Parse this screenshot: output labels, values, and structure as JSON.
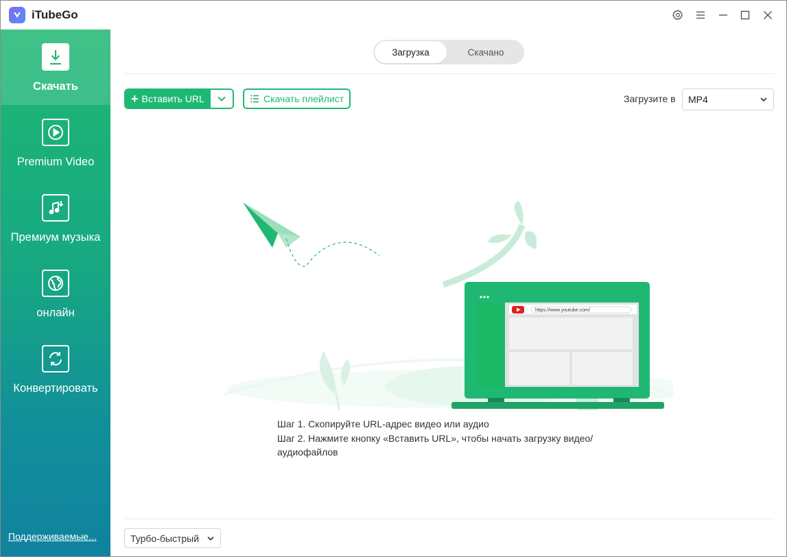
{
  "app": {
    "title": "iTubeGo"
  },
  "sidebar": {
    "items": [
      {
        "label": "Скачать",
        "icon": "download-icon"
      },
      {
        "label": "Premium Video",
        "icon": "play-icon"
      },
      {
        "label": "Премиум музыка",
        "icon": "music-note-icon"
      },
      {
        "label": "онлайн",
        "icon": "globe-icon"
      },
      {
        "label": "Конвертировать",
        "icon": "convert-icon"
      }
    ],
    "supported_link": "Поддерживаемые..."
  },
  "tabs": {
    "download": "Загрузка",
    "downloaded": "Скачано"
  },
  "toolbar": {
    "paste_url": "Вставить URL",
    "download_playlist": "Скачать плейлист",
    "format_label": "Загрузите в",
    "format_value": "MP4"
  },
  "illustration": {
    "url_bar_text": "https://www.youtube.com/"
  },
  "steps": {
    "step1": "Шаг 1. Скопируйте URL-адрес видео или аудио",
    "step2": "Шаг 2. Нажмите кнопку «Вставить URL», чтобы начать загрузку видео/ аудиофайлов"
  },
  "footer": {
    "speed_mode": "Турбо-быстрый"
  },
  "colors": {
    "accent": "#1fb873",
    "sidebar_top": "#1fb873",
    "sidebar_bottom": "#10829f"
  }
}
